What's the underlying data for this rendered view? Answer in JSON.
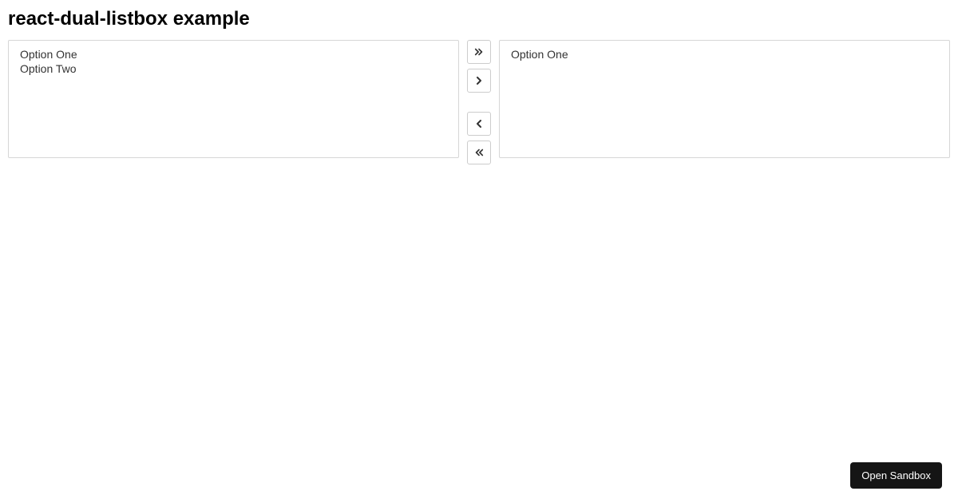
{
  "title": "react-dual-listbox example",
  "available": {
    "options": [
      "Option One",
      "Option Two"
    ]
  },
  "selected": {
    "options": [
      "Option One"
    ]
  },
  "actions": {
    "move_all_right": "Move all right",
    "move_right": "Move right",
    "move_left": "Move left",
    "move_all_left": "Move all left"
  },
  "open_sandbox": "Open Sandbox"
}
